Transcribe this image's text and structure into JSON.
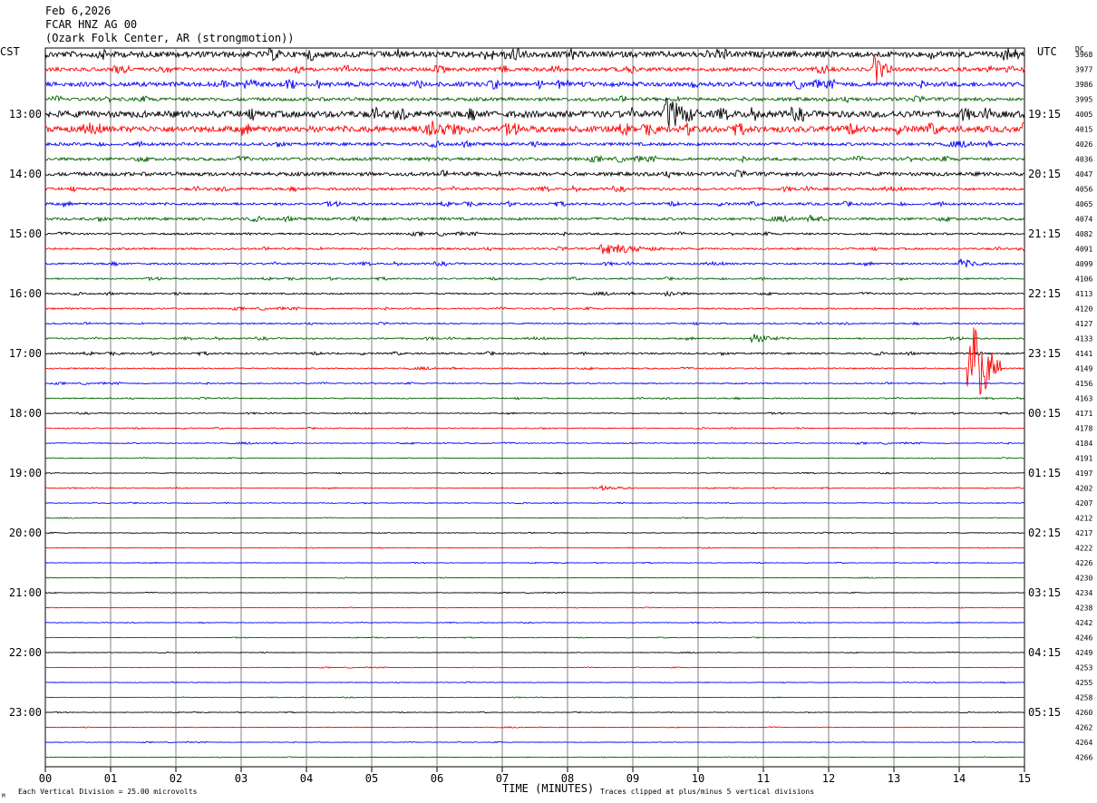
{
  "header": {
    "date": "Feb 6,2026",
    "station": "FCAR HNZ AG 00",
    "location": "(Ozark Folk Center, AR (strongmotion))"
  },
  "left_tz": "CST",
  "right_tz": "UTC",
  "dc_label": "DC",
  "footer": {
    "scale_note": "Each Vertical Division =   25.00 microvolts",
    "clip_note": "Traces clipped at plus/minus 5 vertical divisions",
    "corner_mark": "M"
  },
  "colors": {
    "palette": [
      "#000000",
      "#ff0000",
      "#0000ff",
      "#006400"
    ],
    "grid": "#808080"
  },
  "chart_data": {
    "type": "line",
    "xlabel": "TIME (MINUTES)",
    "xlim": [
      0,
      15
    ],
    "x_ticks": [
      "00",
      "01",
      "02",
      "03",
      "04",
      "05",
      "06",
      "07",
      "08",
      "09",
      "10",
      "11",
      "12",
      "13",
      "14",
      "15"
    ],
    "left_hour_labels": [
      "13:00",
      "14:00",
      "15:00",
      "16:00",
      "17:00",
      "18:00",
      "19:00",
      "20:00",
      "21:00",
      "22:00",
      "23:00"
    ],
    "right_hour_labels": [
      "19:15",
      "20:15",
      "21:15",
      "22:15",
      "23:15",
      "00:15",
      "01:15",
      "02:15",
      "03:15",
      "04:15",
      "05:15"
    ],
    "first_hour_label_row": 4,
    "rows_per_hour": 4,
    "dc_offsets": [
      3968,
      3977,
      3986,
      3995,
      4005,
      4015,
      4026,
      4036,
      4047,
      4056,
      4065,
      4074,
      4082,
      4091,
      4099,
      4106,
      4113,
      4120,
      4127,
      4133,
      4141,
      4149,
      4156,
      4163,
      4171,
      4178,
      4184,
      4191,
      4197,
      4202,
      4207,
      4212,
      4217,
      4222,
      4226,
      4230,
      4234,
      4238,
      4242,
      4246,
      4249,
      4253,
      4255,
      4258,
      4260,
      4262,
      4264,
      4266
    ],
    "row_activity": [
      3.2,
      2.0,
      2.4,
      1.8,
      3.5,
      3.3,
      1.6,
      1.6,
      2.0,
      1.4,
      1.3,
      1.4,
      1.0,
      1.0,
      1.0,
      0.8,
      0.8,
      0.8,
      0.7,
      0.8,
      0.9,
      0.7,
      0.6,
      0.6,
      0.5,
      0.5,
      0.5,
      0.4,
      0.4,
      0.4,
      0.4,
      0.3,
      0.4,
      0.3,
      0.3,
      0.3,
      0.3,
      0.3,
      0.3,
      0.3,
      0.3,
      0.3,
      0.3,
      0.3,
      0.3,
      0.3,
      0.3,
      0.3
    ],
    "events": [
      {
        "row": 21,
        "minute": 14.15,
        "amplitude": 60,
        "duration": 0.5
      },
      {
        "row": 4,
        "minute": 9.5,
        "amplitude": 22,
        "duration": 0.6
      },
      {
        "row": 1,
        "minute": 12.7,
        "amplitude": 18,
        "duration": 0.3
      },
      {
        "row": 5,
        "minute": 5.8,
        "amplitude": 12,
        "duration": 1.2
      },
      {
        "row": 13,
        "minute": 8.5,
        "amplitude": 7,
        "duration": 1.2
      },
      {
        "row": 14,
        "minute": 14.0,
        "amplitude": 6,
        "duration": 0.5
      },
      {
        "row": 19,
        "minute": 10.8,
        "amplitude": 6,
        "duration": 0.6
      },
      {
        "row": 11,
        "minute": 11.7,
        "amplitude": 5,
        "duration": 0.5
      },
      {
        "row": 16,
        "minute": 9.5,
        "amplitude": 4,
        "duration": 0.5
      },
      {
        "row": 29,
        "minute": 8.5,
        "amplitude": 3,
        "duration": 0.6
      }
    ]
  }
}
